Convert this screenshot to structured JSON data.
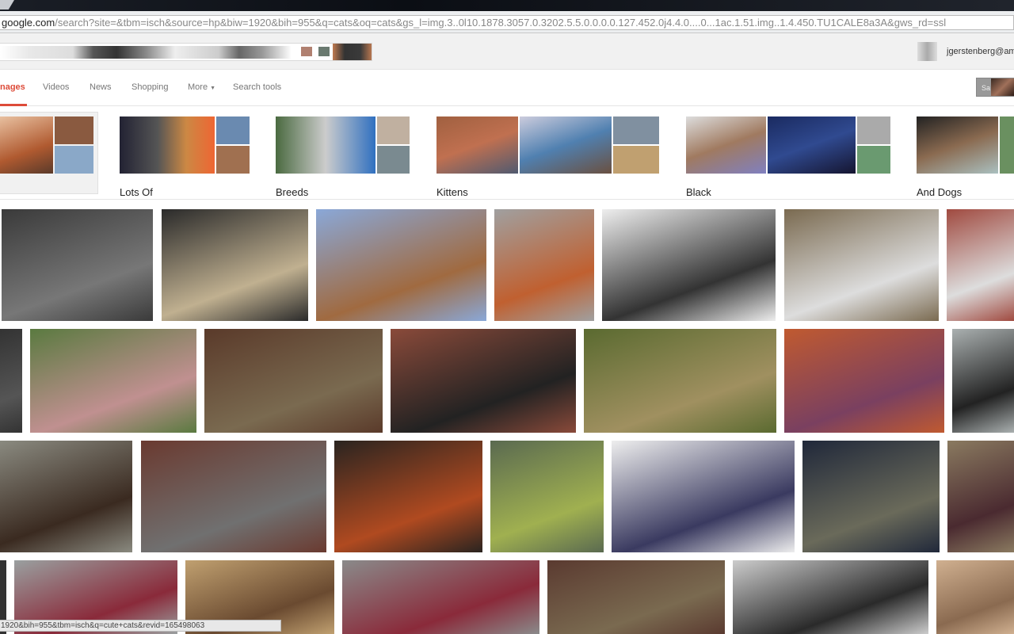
{
  "browser": {
    "url_host": "google.com",
    "url_path": "/search?site=&tbm=isch&source=hp&biw=1920&bih=955&q=cats&oq=cats&gs_l=img.3..0l10.1878.3057.0.3202.5.5.0.0.0.0.127.452.0j4.4.0....0...1ac.1.51.img..1.4.450.TU1CALE8a3A&gws_rd=ssl"
  },
  "header": {
    "account": "jgerstenberg@am",
    "safesearch_label": "Sa"
  },
  "tabs": [
    {
      "label": "nages",
      "active": true
    },
    {
      "label": "Videos"
    },
    {
      "label": "News"
    },
    {
      "label": "Shopping"
    },
    {
      "label": "More"
    },
    {
      "label": "Search tools"
    }
  ],
  "related": [
    {
      "label": ""
    },
    {
      "label": "Lots Of"
    },
    {
      "label": "Breeds"
    },
    {
      "label": "Kittens"
    },
    {
      "label": "Black"
    },
    {
      "label": "And Dogs"
    }
  ],
  "status_bar": "1920&bih=955&tbm=isch&q=cute+cats&revid=165498063",
  "colors": {
    "accent": "#dd4b39"
  }
}
